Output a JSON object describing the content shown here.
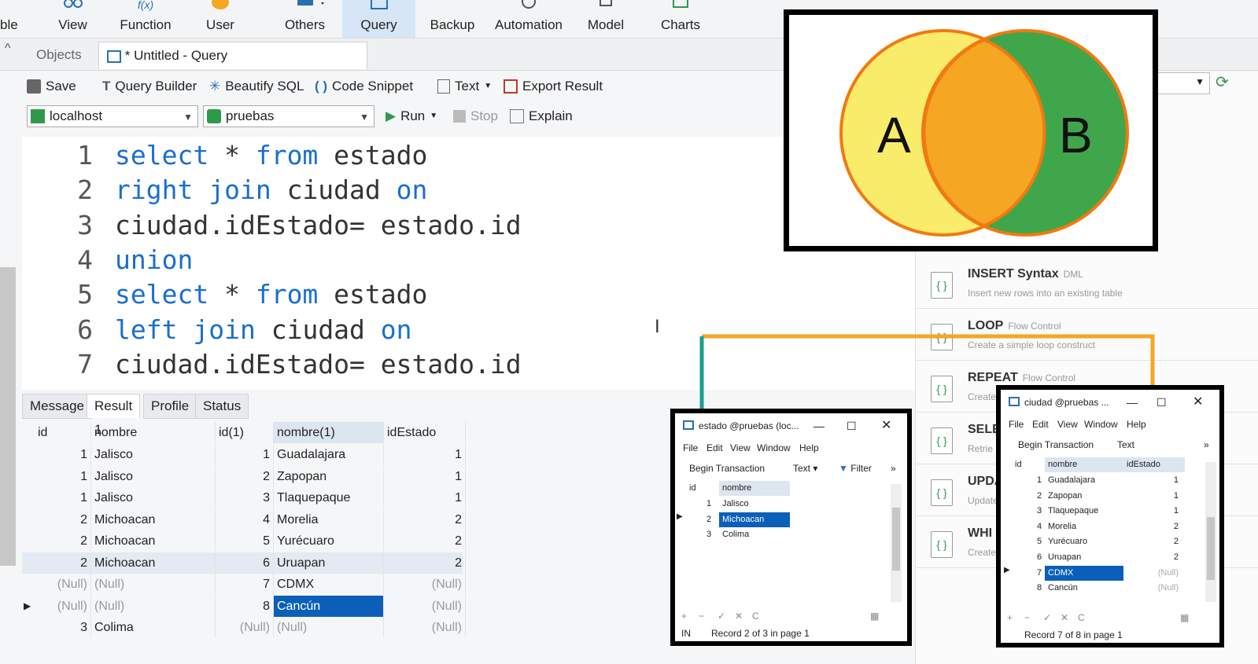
{
  "ribbon": {
    "items": [
      {
        "label": "ble"
      },
      {
        "label": "View"
      },
      {
        "label": "Function"
      },
      {
        "label": "User"
      },
      {
        "label": "Others"
      },
      {
        "label": "Query"
      },
      {
        "label": "Backup"
      },
      {
        "label": "Automation"
      },
      {
        "label": "Model"
      },
      {
        "label": "Charts"
      }
    ]
  },
  "tabs": {
    "objects": "Objects",
    "query": "* Untitled - Query"
  },
  "toolbar": {
    "save": "Save",
    "query_builder": "Query Builder",
    "beautify": "Beautify SQL",
    "snippet": "Code Snippet",
    "text": "Text",
    "export": "Export Result",
    "connection": "localhost",
    "database": "pruebas",
    "run": "Run",
    "stop": "Stop",
    "explain": "Explain"
  },
  "editor": {
    "lines": [
      {
        "n": "1",
        "parts": [
          {
            "k": "select"
          },
          {
            "t": " * "
          },
          {
            "k": "from"
          },
          {
            "t": " estado"
          }
        ]
      },
      {
        "n": "2",
        "parts": [
          {
            "k": "right"
          },
          {
            "t": " "
          },
          {
            "k": "join"
          },
          {
            "t": " ciudad "
          },
          {
            "k": "on"
          }
        ]
      },
      {
        "n": "3",
        "parts": [
          {
            "t": "ciudad.idEstado= estado.id"
          }
        ]
      },
      {
        "n": "4",
        "parts": [
          {
            "k": "union"
          }
        ]
      },
      {
        "n": "5",
        "parts": [
          {
            "k": "select"
          },
          {
            "t": " * "
          },
          {
            "k": "from"
          },
          {
            "t": " estado"
          }
        ]
      },
      {
        "n": "6",
        "parts": [
          {
            "k": "left"
          },
          {
            "t": " "
          },
          {
            "k": "join"
          },
          {
            "t": " ciudad "
          },
          {
            "k": "on"
          }
        ]
      },
      {
        "n": "7",
        "parts": [
          {
            "t": "ciudad.idEstado= estado.id"
          }
        ]
      }
    ]
  },
  "result_tabs": [
    "Message",
    "Result 1",
    "Profile",
    "Status"
  ],
  "result": {
    "columns": [
      "id",
      "nombre",
      "id(1)",
      "nombre(1)",
      "idEstado"
    ],
    "rows": [
      [
        "1",
        "Jalisco",
        "1",
        "Guadalajara",
        "1"
      ],
      [
        "1",
        "Jalisco",
        "2",
        "Zapopan",
        "1"
      ],
      [
        "1",
        "Jalisco",
        "3",
        "Tlaquepaque",
        "1"
      ],
      [
        "2",
        "Michoacan",
        "4",
        "Morelia",
        "2"
      ],
      [
        "2",
        "Michoacan",
        "5",
        "Yurécuaro",
        "2"
      ],
      [
        "2",
        "Michoacan",
        "6",
        "Uruapan",
        "2"
      ],
      [
        "(Null)",
        "(Null)",
        "7",
        "CDMX",
        "(Null)"
      ],
      [
        "(Null)",
        "(Null)",
        "8",
        "Cancún",
        "(Null)"
      ],
      [
        "3",
        "Colima",
        "(Null)",
        "(Null)",
        "(Null)"
      ]
    ]
  },
  "venn": {
    "a": "A",
    "b": "B"
  },
  "snippets": [
    {
      "title": "INSERT Syntax",
      "tag": "DML",
      "desc": "Insert new rows into an existing table"
    },
    {
      "title": "LOOP",
      "tag": "Flow Control",
      "desc": "Create a simple loop construct"
    },
    {
      "title": "REPEAT",
      "tag": "Flow Control",
      "desc": "Create"
    },
    {
      "title": "SELE",
      "tag": "",
      "desc": "Retrie"
    },
    {
      "title": "UPDA",
      "tag": "",
      "desc": "Update"
    },
    {
      "title": "WHI",
      "tag": "",
      "desc": "Create"
    }
  ],
  "estado_win": {
    "title": "estado @pruebas (loc...",
    "menu": [
      "File",
      "Edit",
      "View",
      "Window",
      "Help"
    ],
    "begin": "Begin Transaction",
    "text": "Text",
    "filter": "Filter",
    "cols": [
      "id",
      "nombre"
    ],
    "rows": [
      [
        "1",
        "Jalisco"
      ],
      [
        "2",
        "Michoacan"
      ],
      [
        "3",
        "Colima"
      ]
    ],
    "mode": "IN",
    "status": "Record 2 of 3 in page 1"
  },
  "ciudad_win": {
    "title": "ciudad @pruebas ...",
    "menu": [
      "File",
      "Edit",
      "View",
      "Window",
      "Help"
    ],
    "begin": "Begin Transaction",
    "text": "Text",
    "cols": [
      "id",
      "nombre",
      "idEstado"
    ],
    "rows": [
      [
        "1",
        "Guadalajara",
        "1"
      ],
      [
        "2",
        "Zapopan",
        "1"
      ],
      [
        "3",
        "Tlaquepaque",
        "1"
      ],
      [
        "4",
        "Morelia",
        "2"
      ],
      [
        "5",
        "Yurécuaro",
        "2"
      ],
      [
        "6",
        "Uruapan",
        "2"
      ],
      [
        "7",
        "CDMX",
        "(Null)"
      ],
      [
        "8",
        "Cancún",
        "(Null)"
      ]
    ],
    "status": "Record 7 of 8 in page 1"
  },
  "colors": {
    "accent": "#1a6ed0",
    "selection": "#0b5fb8",
    "venn_a": "#f9ec6a",
    "venn_b": "#3fa64b",
    "venn_mid": "#f5a623",
    "arrow_teal": "#1a9e8f",
    "arrow_orange": "#f5a623"
  }
}
